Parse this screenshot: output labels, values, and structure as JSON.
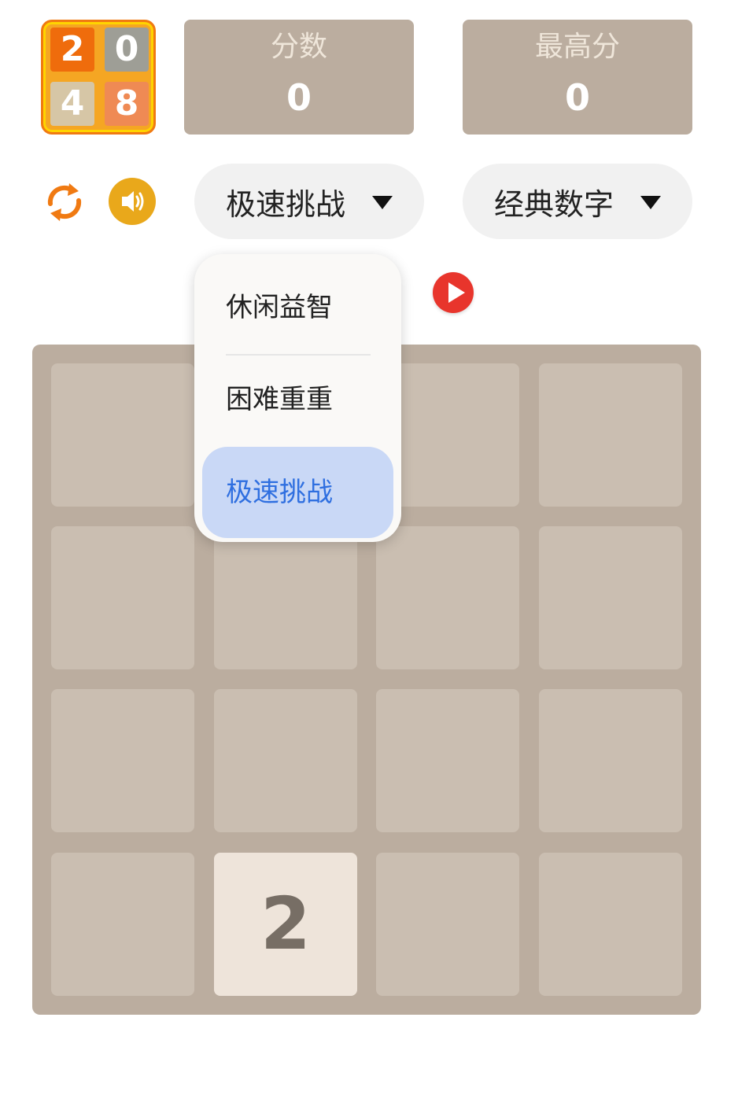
{
  "logo": {
    "tiles": [
      "2",
      "0",
      "4",
      "8"
    ]
  },
  "score": {
    "label": "分数",
    "value": "0"
  },
  "best": {
    "label": "最高分",
    "value": "0"
  },
  "controls": {
    "refresh_icon": "refresh-icon",
    "sound_icon": "speaker-icon",
    "mode_dropdown": "极速挑战",
    "theme_dropdown": "经典数字",
    "play_icon": "play-icon"
  },
  "menu": {
    "items": [
      "休闲益智",
      "困难重重",
      "极速挑战"
    ],
    "selected": "极速挑战"
  },
  "board": {
    "rows": [
      [
        "",
        "",
        "",
        ""
      ],
      [
        "",
        "",
        "",
        ""
      ],
      [
        "",
        "",
        "",
        ""
      ],
      [
        "",
        "2",
        "",
        ""
      ]
    ]
  },
  "colors": {
    "board": "#bbad9f",
    "empty_cell": "#cabeb1",
    "tile_2": "#eee4da",
    "menu_selected": "#c9d8f6",
    "accent_blue": "#2f6fe0"
  }
}
